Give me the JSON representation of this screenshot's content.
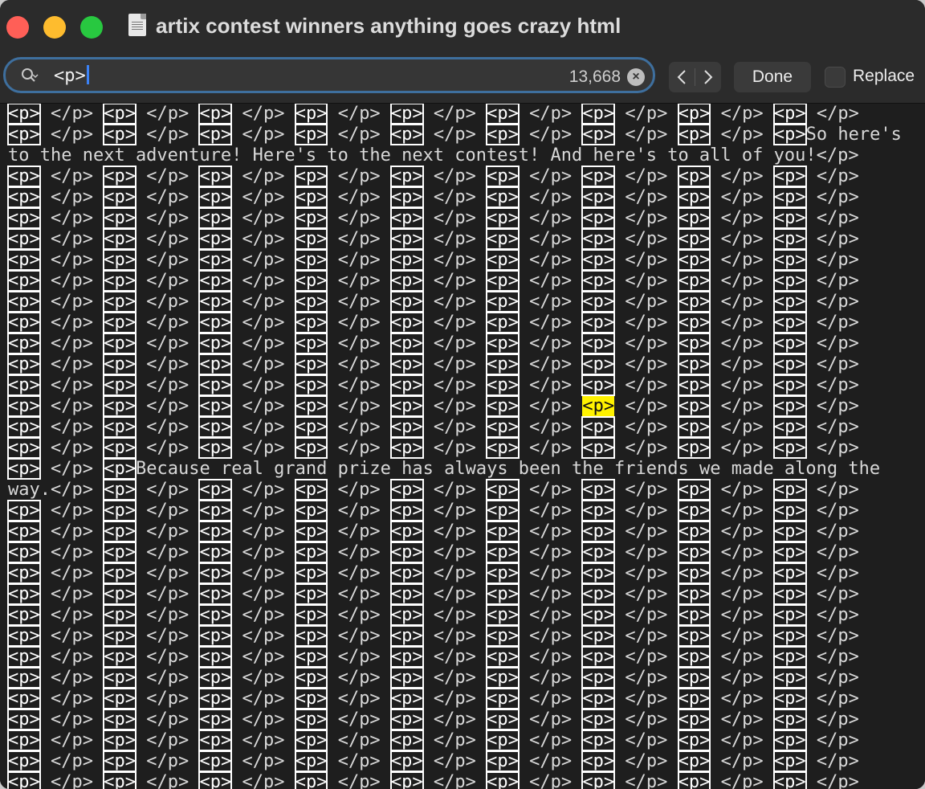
{
  "window": {
    "title": "artix contest winners anything goes crazy html"
  },
  "colors": {
    "close": "#ff5f57",
    "minimize": "#febc2e",
    "maximize": "#28c840",
    "focus_ring": "#3e6f9e",
    "current_match": "#fff200",
    "editor_background": "#1e1e1e"
  },
  "find_bar": {
    "search_value": "<p>",
    "match_count": "13,668",
    "prev_icon": "chevron-left-icon",
    "next_icon": "chevron-right-icon",
    "done_label": "Done",
    "replace_label": "Replace",
    "replace_checked": false
  },
  "editor": {
    "unit_open": "<p>",
    "unit_close": "</p>",
    "lines": [
      "<p> </p> <p> </p> <p> </p> <p> </p> <p> </p> <p> </p> <p> </p> <p> </p> <p> </p>",
      "<p> </p> <p> </p> <p> </p> <p> </p> <p> </p> <p> </p> <p> </p> <p> </p> <p>So here's",
      "to the next adventure! Here's to the next contest! And here's to all of you!</p>",
      "<p> </p> <p> </p> <p> </p> <p> </p> <p> </p> <p> </p> <p> </p> <p> </p> <p> </p>",
      "<p> </p> <p> </p> <p> </p> <p> </p> <p> </p> <p> </p> <p> </p> <p> </p> <p> </p>",
      "<p> </p> <p> </p> <p> </p> <p> </p> <p> </p> <p> </p> <p> </p> <p> </p> <p> </p>",
      "<p> </p> <p> </p> <p> </p> <p> </p> <p> </p> <p> </p> <p> </p> <p> </p> <p> </p>",
      "<p> </p> <p> </p> <p> </p> <p> </p> <p> </p> <p> </p> <p> </p> <p> </p> <p> </p>",
      "<p> </p> <p> </p> <p> </p> <p> </p> <p> </p> <p> </p> <p> </p> <p> </p> <p> </p>",
      "<p> </p> <p> </p> <p> </p> <p> </p> <p> </p> <p> </p> <p> </p> <p> </p> <p> </p>",
      "<p> </p> <p> </p> <p> </p> <p> </p> <p> </p> <p> </p> <p> </p> <p> </p> <p> </p>",
      "<p> </p> <p> </p> <p> </p> <p> </p> <p> </p> <p> </p> <p> </p> <p> </p> <p> </p>",
      "<p> </p> <p> </p> <p> </p> <p> </p> <p> </p> <p> </p> <p> </p> <p> </p> <p> </p>",
      "<p> </p> <p> </p> <p> </p> <p> </p> <p> </p> <p> </p> <p> </p> <p> </p> <p> </p>",
      "<p> </p> <p> </p> <p> </p> <p> </p> <p> </p> <p> </p> <p> </p> <p> </p> <p> </p>",
      "<p> </p> <p> </p> <p> </p> <p> </p> <p> </p> <p> </p> <p> </p> <p> </p> <p> </p>",
      "<p> </p> <p> </p> <p> </p> <p> </p> <p> </p> <p> </p> <p> </p> <p> </p> <p> </p>",
      "<p> </p> <p>Because real grand prize has always been the friends we made along the",
      "way.</p> <p> </p> <p> </p> <p> </p> <p> </p> <p> </p> <p> </p> <p> </p> <p> </p>",
      "<p> </p> <p> </p> <p> </p> <p> </p> <p> </p> <p> </p> <p> </p> <p> </p> <p> </p>",
      "<p> </p> <p> </p> <p> </p> <p> </p> <p> </p> <p> </p> <p> </p> <p> </p> <p> </p>",
      "<p> </p> <p> </p> <p> </p> <p> </p> <p> </p> <p> </p> <p> </p> <p> </p> <p> </p>",
      "<p> </p> <p> </p> <p> </p> <p> </p> <p> </p> <p> </p> <p> </p> <p> </p> <p> </p>",
      "<p> </p> <p> </p> <p> </p> <p> </p> <p> </p> <p> </p> <p> </p> <p> </p> <p> </p>",
      "<p> </p> <p> </p> <p> </p> <p> </p> <p> </p> <p> </p> <p> </p> <p> </p> <p> </p>",
      "<p> </p> <p> </p> <p> </p> <p> </p> <p> </p> <p> </p> <p> </p> <p> </p> <p> </p>",
      "<p> </p> <p> </p> <p> </p> <p> </p> <p> </p> <p> </p> <p> </p> <p> </p> <p> </p>",
      "<p> </p> <p> </p> <p> </p> <p> </p> <p> </p> <p> </p> <p> </p> <p> </p> <p> </p>",
      "<p> </p> <p> </p> <p> </p> <p> </p> <p> </p> <p> </p> <p> </p> <p> </p> <p> </p>",
      "<p> </p> <p> </p> <p> </p> <p> </p> <p> </p> <p> </p> <p> </p> <p> </p> <p> </p>",
      "<p> </p> <p> </p> <p> </p> <p> </p> <p> </p> <p> </p> <p> </p> <p> </p> <p> </p>",
      "<p> </p> <p> </p> <p> </p> <p> </p> <p> </p> <p> </p> <p> </p> <p> </p> <p> </p>",
      "<p> </p> <p> </p> <p> </p> <p> </p> <p> </p> <p> </p> <p> </p> <p> </p> <p> </p>"
    ],
    "current_match": {
      "line": 14,
      "occurrence": 6
    }
  }
}
